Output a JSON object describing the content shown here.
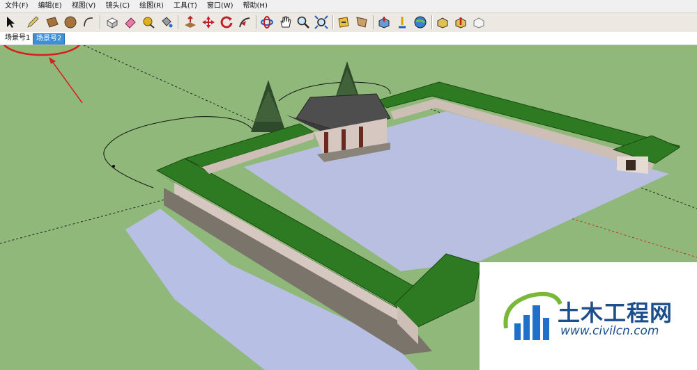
{
  "menu": {
    "items": [
      {
        "label": "文件(F)"
      },
      {
        "label": "编辑(E)"
      },
      {
        "label": "视图(V)"
      },
      {
        "label": "镜头(C)"
      },
      {
        "label": "绘图(R)"
      },
      {
        "label": "工具(T)"
      },
      {
        "label": "窗口(W)"
      },
      {
        "label": "帮助(H)"
      }
    ]
  },
  "toolbar": {
    "tools": [
      "select-icon",
      "pencil-icon",
      "rectangle-icon",
      "circle-icon",
      "arc-icon",
      "make-component-icon",
      "eraser-icon",
      "tape-measure-icon",
      "paint-bucket-icon",
      "push-pull-icon",
      "move-icon",
      "rotate-icon",
      "follow-me-icon",
      "orbit-icon",
      "pan-icon",
      "zoom-icon",
      "zoom-extents-icon",
      "previous-view-icon",
      "next-view-icon",
      "get-models-icon",
      "share-model-icon",
      "google-earth-icon",
      "get-component-icon",
      "share-component-icon",
      "dynamic-component-icon"
    ]
  },
  "scenes": {
    "tabs": [
      {
        "label": "场景号1",
        "active": false
      },
      {
        "label": "场景号2",
        "active": true
      }
    ]
  },
  "colors": {
    "ground": "#8fb87a",
    "courtyard": "#b9bfe0",
    "roof": "#2e7a22",
    "annotation": "#d62020",
    "watermark": "#1d4f8c"
  },
  "watermark": {
    "title": "土木工程网",
    "url": "www.civilcn.com"
  }
}
